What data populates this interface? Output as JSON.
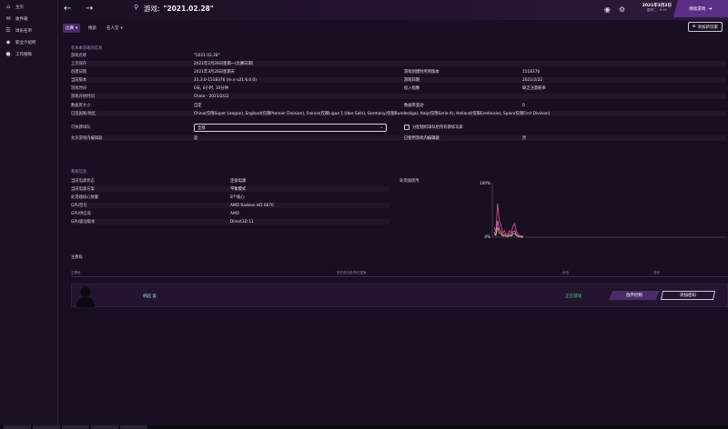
{
  "sidebar": {
    "items": [
      {
        "label": "主页",
        "icon": "home-icon"
      },
      {
        "label": "收件箱",
        "icon": "inbox-icon"
      },
      {
        "label": "球员名单",
        "icon": "squad-icon"
      },
      {
        "label": "职业介绍所",
        "icon": "career-icon"
      },
      {
        "label": "工作保障",
        "icon": "job-security-icon"
      }
    ]
  },
  "header": {
    "title_prefix": "游戏:",
    "title": "\"2021.02.28\"",
    "date": "2021年3月2日",
    "date_sub": "星期二 - 9:00",
    "continue_label": "继续游戏"
  },
  "tabs": [
    {
      "label": "比赛",
      "active": true,
      "dropdown": true
    },
    {
      "label": "搜索",
      "active": false,
      "dropdown": false
    },
    {
      "label": "名人堂",
      "active": false,
      "dropdown": true
    }
  ],
  "add_player_label": "添加新玩家",
  "game_info": {
    "section_title": "有关本游戏的信息",
    "left_rows": [
      {
        "label": "游戏名称",
        "value": "\"2021.02.28\""
      },
      {
        "label": "上次保存",
        "value": "2021年2月28日星期一(比赛日期)"
      },
      {
        "label": "创建日期",
        "value": "2021年3月28日星期天"
      },
      {
        "label": "当前版本",
        "value": "21.3.0-1518376 (m.e v21.6.0.0)"
      },
      {
        "label": "游戏时间",
        "value": "0天, 0小时, 10分钟"
      },
      {
        "label": "游戏开始时间",
        "value": "China - 2021/2/22"
      },
      {
        "label": "数据库大小",
        "value": "自定"
      },
      {
        "label": "已选国家/地区",
        "value": "China(仅限Super League), England(仅限Premier Division), France(仅限Ligue 1 Uber Eats), Germany(仅限Bundesliga), Italy(仅限Serie A), Holland(仅限Eredivisie), Spain(仅限First Division)"
      },
      {
        "label": "可执教球队",
        "value": ""
      },
      {
        "label": "允许游戏内编辑器",
        "value": "是"
      }
    ],
    "right_rows": [
      {
        "label": "游戏创建时所用版本",
        "value": "1518376"
      },
      {
        "label": "游戏日期",
        "value": "2021/2/22"
      },
      {
        "label": "投入指数",
        "value": "缺乏注意赔率"
      },
      {
        "label": "数据库变动",
        "value": "0"
      },
      {
        "label": "已使用游戏内编辑器",
        "value": "否"
      }
    ],
    "coachable_select": "全部",
    "random_assign_label": "分配随机球队给所有教练玩家"
  },
  "system_info": {
    "section_title": "系统信息",
    "rows": [
      {
        "label": "当前电源状态",
        "value": "连接电源"
      },
      {
        "label": "当前电源方案",
        "value": "平衡模式"
      },
      {
        "label": "处理器核心数量",
        "value": "8个核心"
      },
      {
        "label": "GPU型号",
        "value": "AMD Radeon HD 6670"
      },
      {
        "label": "GPU供应商",
        "value": "AMD"
      },
      {
        "label": "GPU驱动版本",
        "value": "Direct3D 11"
      }
    ],
    "processor_usage_label": "处理器使用"
  },
  "chart_data": {
    "type": "line",
    "title": "",
    "ylim": [
      0,
      100
    ],
    "yticks": [
      "100%",
      "0%"
    ],
    "series": [
      {
        "color": "#e05a8a",
        "values": [
          18,
          10,
          62,
          30,
          22,
          8,
          12,
          6,
          5,
          12,
          8,
          20,
          25,
          10,
          5,
          3,
          2,
          2
        ]
      },
      {
        "color": "#c87adf",
        "values": [
          10,
          5,
          30,
          15,
          10,
          4,
          6,
          3,
          2,
          6,
          4,
          10,
          12,
          5,
          2,
          1,
          1,
          1
        ]
      },
      {
        "color": "#f0b060",
        "values": [
          6,
          3,
          18,
          8,
          6,
          2,
          3,
          2,
          1,
          3,
          2,
          6,
          7,
          3,
          1,
          1,
          0,
          0
        ]
      }
    ]
  },
  "players": {
    "section_title": "主教练",
    "headers": [
      "主教练",
      "所在俱乐部/所在国家",
      "状态",
      "游戏"
    ],
    "rows": [
      {
        "name": "韩超 喜",
        "status": "正在游戏",
        "btn1": "放弃控制",
        "btn2": "添加密码"
      }
    ]
  },
  "colors": {
    "accent": "#5c2f86",
    "status_green": "#46d07f"
  }
}
